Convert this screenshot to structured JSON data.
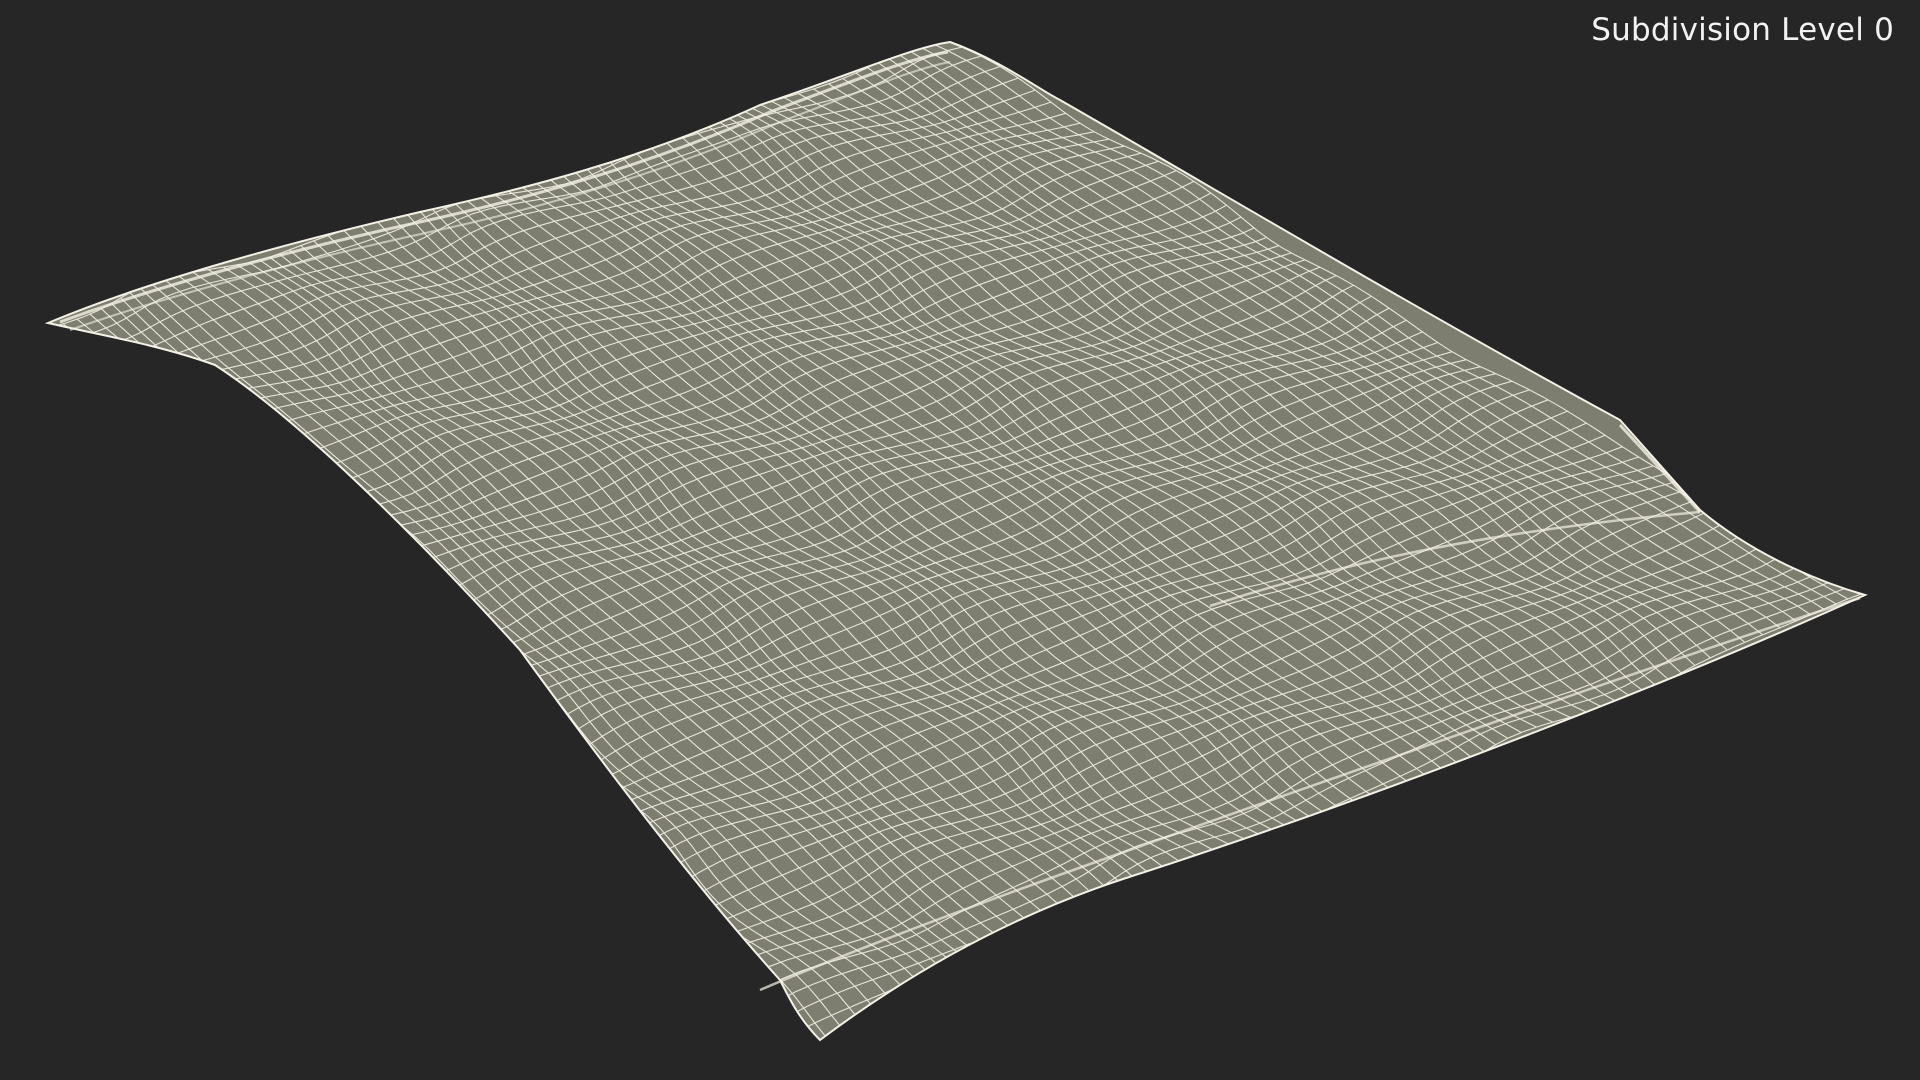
{
  "viewport": {
    "subdivision_label": "Subdivision Level 0"
  },
  "colors": {
    "background": "#262626",
    "surface": "#7e7e70",
    "wire": "#f4f1e6",
    "label": "#f2f2f2"
  },
  "model": {
    "icon": "wireframe-pouch-mesh"
  }
}
